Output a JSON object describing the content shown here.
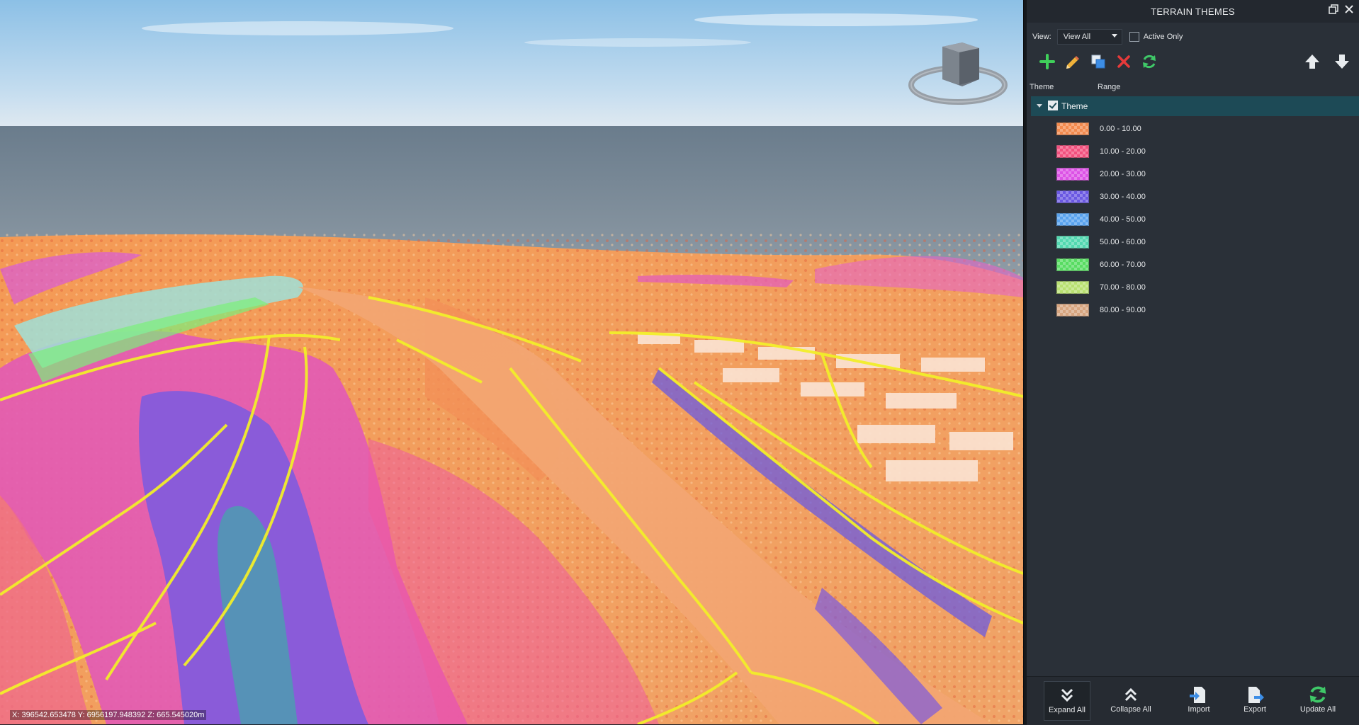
{
  "viewport": {
    "coordinates": "X: 396542.653478 Y: 6956197.948392 Z: 665.545020m",
    "navcube_icon": "navigation-cube-icon"
  },
  "panel": {
    "title": "TERRAIN THEMES",
    "view_label": "View:",
    "view_value": "View All",
    "active_only_label": "Active Only",
    "active_only_checked": false,
    "toolbar": {
      "add_icon": "plus-icon",
      "edit_icon": "pencil-icon",
      "copy_icon": "duplicate-icon",
      "delete_icon": "close-icon",
      "refresh_icon": "refresh-icon",
      "up_icon": "arrow-up-icon",
      "down_icon": "arrow-down-icon"
    },
    "columns": {
      "theme": "Theme",
      "range": "Range"
    },
    "theme": {
      "name": "Theme",
      "checked": true,
      "expanded": true
    },
    "ranges": [
      {
        "label": "0.00 - 10.00",
        "color": "#f28a4e"
      },
      {
        "label": "10.00 - 20.00",
        "color": "#f2507e"
      },
      {
        "label": "20.00 - 30.00",
        "color": "#dc52e6"
      },
      {
        "label": "30.00 - 40.00",
        "color": "#6a58e2"
      },
      {
        "label": "40.00 - 50.00",
        "color": "#58a2ee"
      },
      {
        "label": "50.00 - 60.00",
        "color": "#52d8b0"
      },
      {
        "label": "60.00 - 70.00",
        "color": "#58dc62"
      },
      {
        "label": "70.00 - 80.00",
        "color": "#b8e070"
      },
      {
        "label": "80.00 - 90.00",
        "color": "#d7a580"
      }
    ],
    "bottom_buttons": {
      "expand_all": "Expand All",
      "collapse_all": "Collapse All",
      "import": "Import",
      "export": "Export",
      "update_all": "Update All"
    }
  }
}
